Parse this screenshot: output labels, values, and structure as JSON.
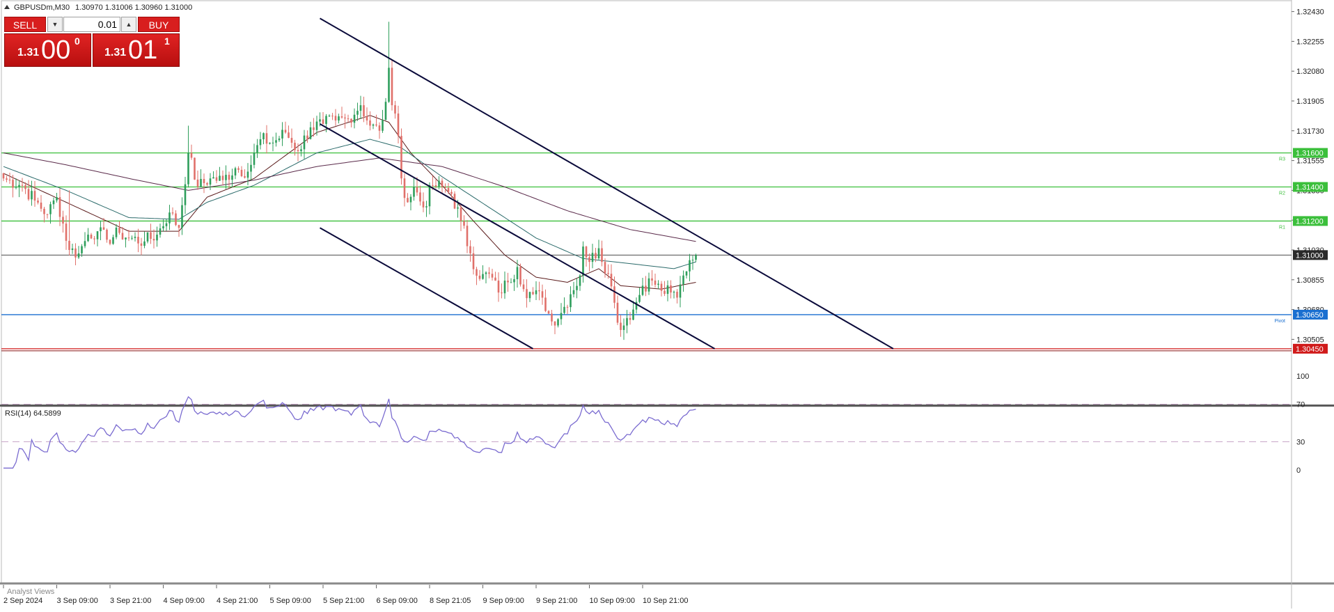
{
  "header": {
    "symbol": "GBPUSDm,M30",
    "ohlc": "1.30970 1.31006 1.30960 1.31000"
  },
  "trade_panel": {
    "sell_label": "SELL",
    "buy_label": "BUY",
    "lot_value": "0.01",
    "sell_price": {
      "prefix": "1.31",
      "big": "00",
      "sup": "0"
    },
    "buy_price": {
      "prefix": "1.31",
      "big": "01",
      "sup": "1"
    }
  },
  "levels": [
    {
      "name": "R3",
      "label": "1.31600",
      "value": 1.316,
      "color": "#3bbf3b",
      "marker": "R3"
    },
    {
      "name": "R2",
      "label": "1.31400",
      "value": 1.314,
      "color": "#3bbf3b",
      "marker": "R2"
    },
    {
      "name": "R1",
      "label": "1.31200",
      "value": 1.312,
      "color": "#3bbf3b",
      "marker": "R1"
    },
    {
      "name": "current",
      "label": "1.31000",
      "value": 1.31,
      "color": "#303030",
      "marker": ""
    },
    {
      "name": "pivot",
      "label": "1.30650",
      "value": 1.3065,
      "color": "#1a6fd0",
      "marker": "Pivot"
    },
    {
      "name": "S1",
      "label": "1.30450",
      "value": 1.3045,
      "color": "#d01a1a",
      "marker": ""
    }
  ],
  "colors": {
    "bull": "#2e9e5b",
    "bear": "#e0706a",
    "channel": "#0a0a3a",
    "rsi": "#7a6bd0",
    "ma_fast": "#5a1a1a",
    "ma_mid": "#2a6a6a",
    "ma_slow": "#5a2a4a"
  },
  "rsi_label": "RSI(14) 64.5899",
  "analyst_label": "Analyst Views",
  "chart_data": [
    {
      "type": "candlestick",
      "symbol": "GBPUSDm",
      "timeframe": "M30",
      "price_axis": {
        "ticks": [
          "1.32430",
          "1.32255",
          "1.32080",
          "1.31905",
          "1.31730",
          "1.31555",
          "1.31380",
          "1.31205",
          "1.31030",
          "1.30855",
          "1.30680",
          "1.30505"
        ],
        "tick_values": [
          1.3243,
          1.32255,
          1.3208,
          1.31905,
          1.3173,
          1.31555,
          1.3138,
          1.31205,
          1.3103,
          1.30855,
          1.3068,
          1.30505
        ],
        "ylim": [
          1.3042,
          1.3252
        ]
      },
      "time_axis": {
        "labels": [
          "2 Sep 2024",
          "3 Sep 09:00",
          "3 Sep 21:00",
          "4 Sep 09:00",
          "4 Sep 21:00",
          "5 Sep 09:00",
          "5 Sep 21:00",
          "6 Sep 09:00",
          "8 Sep 21:05",
          "9 Sep 09:00",
          "9 Sep 21:00",
          "10 Sep 09:00",
          "10 Sep 21:00"
        ],
        "label_bar_index": [
          0,
          17,
          34,
          51,
          68,
          85,
          102,
          119,
          136,
          153,
          170,
          187,
          204
        ],
        "total_bars": 264
      },
      "price_anchors": [
        [
          0,
          1.3145
        ],
        [
          6,
          1.3141
        ],
        [
          10,
          1.3132
        ],
        [
          14,
          1.3124
        ],
        [
          17,
          1.3134
        ],
        [
          21,
          1.3103
        ],
        [
          24,
          1.3101
        ],
        [
          27,
          1.3112
        ],
        [
          30,
          1.3114
        ],
        [
          33,
          1.3109
        ],
        [
          37,
          1.3113
        ],
        [
          40,
          1.311
        ],
        [
          45,
          1.3108
        ],
        [
          49,
          1.3112
        ],
        [
          53,
          1.3125
        ],
        [
          56,
          1.3116
        ],
        [
          59,
          1.316
        ],
        [
          62,
          1.314
        ],
        [
          66,
          1.3145
        ],
        [
          70,
          1.3144
        ],
        [
          74,
          1.3151
        ],
        [
          78,
          1.3149
        ],
        [
          82,
          1.3168
        ],
        [
          86,
          1.3166
        ],
        [
          90,
          1.3172
        ],
        [
          94,
          1.3161
        ],
        [
          98,
          1.3175
        ],
        [
          102,
          1.3177
        ],
        [
          106,
          1.3179
        ],
        [
          110,
          1.318
        ],
        [
          114,
          1.3188
        ],
        [
          117,
          1.3176
        ],
        [
          120,
          1.3173
        ],
        [
          122,
          1.319
        ],
        [
          123,
          1.321
        ],
        [
          124,
          1.3188
        ],
        [
          126,
          1.317
        ],
        [
          127,
          1.3145
        ],
        [
          129,
          1.3131
        ],
        [
          131,
          1.314
        ],
        [
          134,
          1.3128
        ],
        [
          137,
          1.3141
        ],
        [
          140,
          1.314
        ],
        [
          143,
          1.3136
        ],
        [
          146,
          1.312
        ],
        [
          149,
          1.3101
        ],
        [
          152,
          1.3086
        ],
        [
          155,
          1.3089
        ],
        [
          158,
          1.3078
        ],
        [
          161,
          1.3084
        ],
        [
          164,
          1.3093
        ],
        [
          166,
          1.308
        ],
        [
          169,
          1.3077
        ],
        [
          172,
          1.3075
        ],
        [
          175,
          1.3061
        ],
        [
          178,
          1.3066
        ],
        [
          181,
          1.3077
        ],
        [
          184,
          1.3088
        ],
        [
          185,
          1.3105
        ],
        [
          187,
          1.3096
        ],
        [
          190,
          1.3104
        ],
        [
          193,
          1.3089
        ],
        [
          195,
          1.3072
        ],
        [
          197,
          1.3056
        ],
        [
          199,
          1.3063
        ],
        [
          201,
          1.3068
        ],
        [
          204,
          1.3082
        ],
        [
          207,
          1.3085
        ],
        [
          210,
          1.3079
        ],
        [
          213,
          1.3078
        ],
        [
          215,
          1.3075
        ],
        [
          217,
          1.3088
        ],
        [
          219,
          1.3097
        ],
        [
          221,
          1.31
        ]
      ],
      "moving_averages": [
        {
          "points": [
            [
              0,
              1.3148
            ],
            [
              20,
              1.3131
            ],
            [
              40,
              1.3114
            ],
            [
              56,
              1.3114
            ],
            [
              65,
              1.3134
            ],
            [
              80,
              1.3145
            ],
            [
              100,
              1.3172
            ],
            [
              117,
              1.3182
            ],
            [
              123,
              1.3178
            ],
            [
              130,
              1.316
            ],
            [
              140,
              1.3141
            ],
            [
              150,
              1.312
            ],
            [
              160,
              1.31
            ],
            [
              170,
              1.3087
            ],
            [
              180,
              1.3084
            ],
            [
              190,
              1.3092
            ],
            [
              197,
              1.3082
            ],
            [
              210,
              1.308
            ],
            [
              221,
              1.3084
            ]
          ]
        },
        {
          "points": [
            [
              0,
              1.3152
            ],
            [
              20,
              1.3138
            ],
            [
              40,
              1.3122
            ],
            [
              56,
              1.3121
            ],
            [
              65,
              1.3131
            ],
            [
              80,
              1.3141
            ],
            [
              100,
              1.316
            ],
            [
              117,
              1.3168
            ],
            [
              127,
              1.3163
            ],
            [
              140,
              1.3146
            ],
            [
              155,
              1.3128
            ],
            [
              170,
              1.311
            ],
            [
              185,
              1.3098
            ],
            [
              200,
              1.3095
            ],
            [
              214,
              1.3092
            ],
            [
              221,
              1.3096
            ]
          ]
        },
        {
          "points": [
            [
              0,
              1.316
            ],
            [
              20,
              1.3153
            ],
            [
              40,
              1.3145
            ],
            [
              59,
              1.3138
            ],
            [
              80,
              1.3144
            ],
            [
              100,
              1.3152
            ],
            [
              120,
              1.3157
            ],
            [
              140,
              1.3152
            ],
            [
              160,
              1.314
            ],
            [
              180,
              1.3126
            ],
            [
              200,
              1.3115
            ],
            [
              221,
              1.3108
            ]
          ]
        }
      ],
      "trend_lines": [
        {
          "from": [
            101,
            1.3239
          ],
          "to": [
            284,
            1.3045
          ]
        },
        {
          "from": [
            101,
            1.3177
          ],
          "to": [
            227,
            1.3045
          ]
        },
        {
          "from": [
            101,
            1.3116
          ],
          "to": [
            169,
            1.3045
          ]
        }
      ]
    },
    {
      "type": "line",
      "title": "RSI(14) 64.5899",
      "ylim": [
        0,
        100
      ],
      "ticks": [
        "100",
        "70",
        "30",
        "0"
      ],
      "tick_values": [
        100,
        70,
        30,
        0
      ],
      "levels": [
        70,
        30
      ],
      "last_value": 64.5899
    }
  ]
}
